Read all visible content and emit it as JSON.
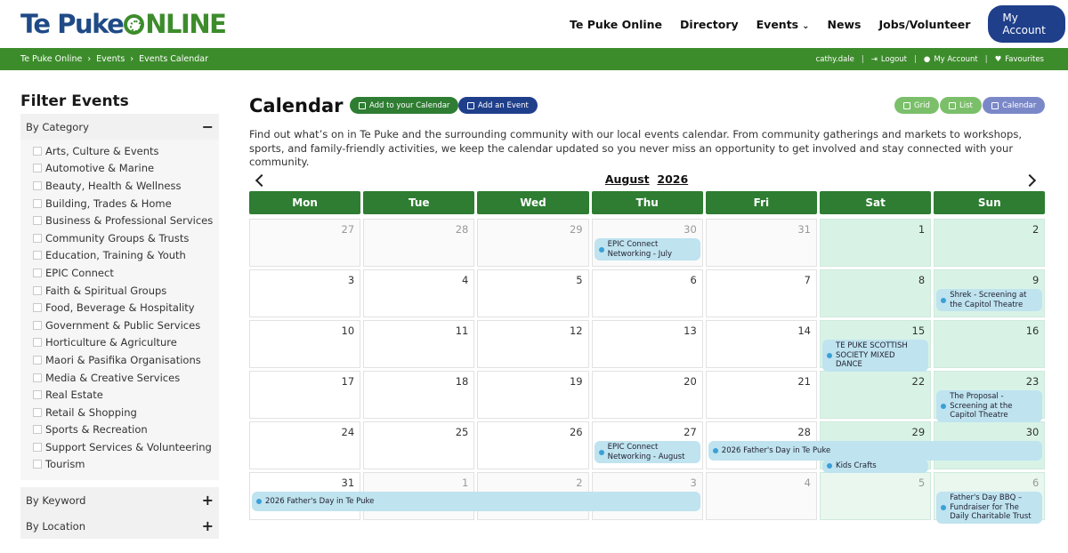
{
  "header": {
    "logo_part1": "Te Puke",
    "logo_part2": "NLINE",
    "nav": [
      {
        "label": "Te Puke Online"
      },
      {
        "label": "Directory"
      },
      {
        "label": "Events",
        "caret": "⌄"
      },
      {
        "label": "News"
      },
      {
        "label": "Jobs/Volunteer"
      }
    ],
    "my_account": "My Account"
  },
  "breadcrumb": {
    "items": [
      "Te Puke Online",
      "Events",
      "Events Calendar"
    ],
    "sep": "›"
  },
  "user_links": {
    "user": "cathy.dale",
    "logout": "Logout",
    "account": "My Account",
    "favourites": "Favourites"
  },
  "sidebar": {
    "title": "Filter Events",
    "category_label": "By Category",
    "category_sign": "−",
    "categories": [
      "Arts, Culture & Events",
      "Automotive & Marine",
      "Beauty, Health & Wellness",
      "Building, Trades & Home",
      "Business & Professional Services",
      "Community Groups & Trusts",
      "Education, Training & Youth",
      "EPIC Connect",
      "Faith & Spiritual Groups",
      "Food, Beverage & Hospitality",
      "Government & Public Services",
      "Horticulture & Agriculture",
      "Maori & Pasifika Organisations",
      "Media & Creative Services",
      "Real Estate",
      "Retail & Shopping",
      "Sports & Recreation",
      "Support Services & Volunteering",
      "Tourism"
    ],
    "keyword_label": "By Keyword",
    "keyword_sign": "+",
    "location_label": "By Location",
    "location_sign": "+"
  },
  "main": {
    "title": "Calendar",
    "add_to_calendar": "Add to your Calendar",
    "add_event": "Add an Event",
    "view_grid": "Grid",
    "view_list": "List",
    "view_calendar": "Calendar",
    "intro": "Find out what’s on in Te Puke and the surrounding community with our local events calendar. From community gatherings and markets to workshops, sports, and family-friendly activities, we keep the calendar updated so you never miss an opportunity to get involved and stay connected with your community.",
    "month": "August",
    "year": "2026"
  },
  "calendar": {
    "days": [
      "Mon",
      "Tue",
      "Wed",
      "Thu",
      "Fri",
      "Sat",
      "Sun"
    ],
    "weeks": [
      [
        {
          "d": "27",
          "o": true
        },
        {
          "d": "28",
          "o": true
        },
        {
          "d": "29",
          "o": true
        },
        {
          "d": "30",
          "o": true
        },
        {
          "d": "31",
          "o": true
        },
        {
          "d": "1"
        },
        {
          "d": "2"
        }
      ],
      [
        {
          "d": "3"
        },
        {
          "d": "4"
        },
        {
          "d": "5"
        },
        {
          "d": "6"
        },
        {
          "d": "7"
        },
        {
          "d": "8"
        },
        {
          "d": "9"
        }
      ],
      [
        {
          "d": "10"
        },
        {
          "d": "11"
        },
        {
          "d": "12"
        },
        {
          "d": "13"
        },
        {
          "d": "14"
        },
        {
          "d": "15"
        },
        {
          "d": "16"
        }
      ],
      [
        {
          "d": "17"
        },
        {
          "d": "18"
        },
        {
          "d": "19"
        },
        {
          "d": "20"
        },
        {
          "d": "21"
        },
        {
          "d": "22"
        },
        {
          "d": "23"
        }
      ],
      [
        {
          "d": "24"
        },
        {
          "d": "25"
        },
        {
          "d": "26"
        },
        {
          "d": "27"
        },
        {
          "d": "28"
        },
        {
          "d": "29"
        },
        {
          "d": "30"
        }
      ],
      [
        {
          "d": "31"
        },
        {
          "d": "1",
          "o": true
        },
        {
          "d": "2",
          "o": true
        },
        {
          "d": "3",
          "o": true
        },
        {
          "d": "4",
          "o": true
        },
        {
          "d": "5",
          "o": true
        },
        {
          "d": "6",
          "o": true
        }
      ]
    ],
    "events": [
      {
        "title": "EPIC Connect Networking - July",
        "week": 0,
        "start": 3,
        "span": 1,
        "lane": 0
      },
      {
        "title": "Shrek - Screening at the Capitol Theatre",
        "week": 1,
        "start": 6,
        "span": 1,
        "lane": 0
      },
      {
        "title": "TE PUKE SCOTTISH SOCIETY MIXED DANCE",
        "week": 2,
        "start": 5,
        "span": 1,
        "lane": 0
      },
      {
        "title": "The Proposal - Screening at the Capitol Theatre",
        "week": 3,
        "start": 6,
        "span": 1,
        "lane": 0
      },
      {
        "title": "EPIC Connect Networking - August",
        "week": 4,
        "start": 3,
        "span": 1,
        "lane": 0
      },
      {
        "title": "2026 Father's Day in Te Puke",
        "week": 4,
        "start": 4,
        "span": 3,
        "lane": 0
      },
      {
        "title": "Kids Crafts",
        "week": 4,
        "start": 5,
        "span": 1,
        "lane": 1
      },
      {
        "title": "2026 Father's Day in Te Puke",
        "week": 5,
        "start": 0,
        "span": 4,
        "lane": 0
      },
      {
        "title": "Father's Day BBQ – Fundraiser for The Daily Charitable Trust",
        "week": 5,
        "start": 6,
        "span": 1,
        "lane": 0
      }
    ]
  }
}
